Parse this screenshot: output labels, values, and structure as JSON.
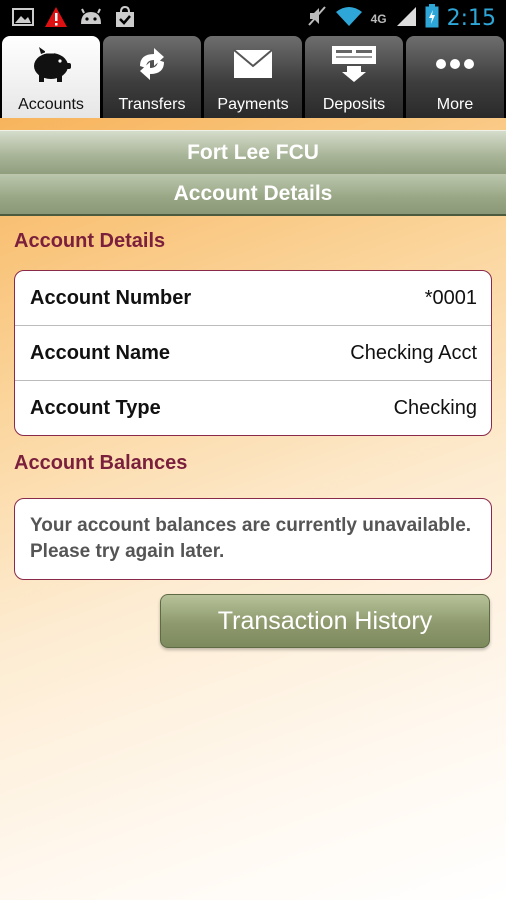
{
  "statusbar": {
    "network": "4G",
    "time": "2:15",
    "time_color": "#2ea7d8"
  },
  "tabs": [
    {
      "label": "Accounts",
      "icon": "piggy-bank-icon",
      "active": true
    },
    {
      "label": "Transfers",
      "icon": "transfer-arrows-icon",
      "active": false
    },
    {
      "label": "Payments",
      "icon": "envelope-icon",
      "active": false
    },
    {
      "label": "Deposits",
      "icon": "deposit-check-icon",
      "active": false
    },
    {
      "label": "More",
      "icon": "more-dots-icon",
      "active": false
    }
  ],
  "header": {
    "institution": "Fort Lee FCU",
    "page_title": "Account Details"
  },
  "details": {
    "title": "Account Details",
    "rows": [
      {
        "label": "Account Number",
        "value": "*0001"
      },
      {
        "label": "Account Name",
        "value": "Checking Acct"
      },
      {
        "label": "Account Type",
        "value": "Checking"
      }
    ]
  },
  "balances": {
    "title": "Account Balances",
    "message": "Your account balances are currently unavailable. Please try again later."
  },
  "actions": {
    "transaction_history": "Transaction History"
  },
  "colors": {
    "accent": "#7a1f3c",
    "header_green": "#98a685"
  }
}
